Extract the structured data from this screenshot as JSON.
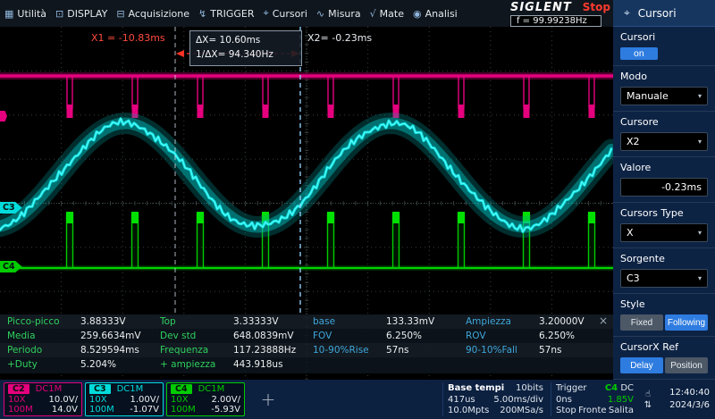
{
  "topbar": {
    "menu": [
      {
        "label": "Utilità",
        "icon": "▦"
      },
      {
        "label": "DISPLAY",
        "icon": "⊡"
      },
      {
        "label": "Acquisizione",
        "icon": "⊟"
      },
      {
        "label": "TRIGGER",
        "icon": "↯"
      },
      {
        "label": "Cursori",
        "icon": "⌖"
      },
      {
        "label": "Misura",
        "icon": "∿"
      },
      {
        "label": "Mate",
        "icon": "√"
      },
      {
        "label": "Analisi",
        "icon": "◉"
      }
    ],
    "brand": "SIGLENT",
    "acq_status": "Stop",
    "freq_counter": "f = 99.99238Hz"
  },
  "plot": {
    "x1_label": "X1 = -10.83ms",
    "x2_label": "X2= -0.23ms",
    "dx_label": "ΔX= 10.60ms",
    "inv_dx_label": "1/ΔX= 94.340Hz",
    "c3_tab": "C3",
    "c4_tab": "C4"
  },
  "measure": {
    "close_icon": "×",
    "rows": [
      [
        {
          "l": "Picco-picco",
          "v": "3.88333V",
          "c": "g"
        },
        {
          "l": "Top",
          "v": "3.33333V",
          "c": "g"
        },
        {
          "l": "base",
          "v": "133.33mV",
          "c": "b"
        },
        {
          "l": "Ampiezza",
          "v": "3.20000V",
          "c": "b"
        }
      ],
      [
        {
          "l": "Media",
          "v": "259.6634mV",
          "c": "g"
        },
        {
          "l": "Dev std",
          "v": "648.0839mV",
          "c": "g"
        },
        {
          "l": "FOV",
          "v": "6.250%",
          "c": "b"
        },
        {
          "l": "ROV",
          "v": "6.250%",
          "c": "b"
        }
      ],
      [
        {
          "l": "Periodo",
          "v": "8.529594ms",
          "c": "g"
        },
        {
          "l": "Frequenza",
          "v": "117.23888Hz",
          "c": "g"
        },
        {
          "l": "10-90%Rise",
          "v": "57ns",
          "c": "b"
        },
        {
          "l": "90-10%Fall",
          "v": "57ns",
          "c": "b"
        }
      ],
      [
        {
          "l": "+Duty",
          "v": "5.204%",
          "c": "g"
        },
        {
          "l": "+ ampiezza",
          "v": "443.918us",
          "c": "g"
        }
      ]
    ]
  },
  "sidebar": {
    "title": "Cursori",
    "title_icon": "⌖",
    "chevron": "▾",
    "sections": [
      {
        "type": "toggle",
        "label": "Cursori",
        "value": "on"
      },
      {
        "type": "select",
        "label": "Modo",
        "value": "Manuale"
      },
      {
        "type": "select",
        "label": "Cursore",
        "value": "X2"
      },
      {
        "type": "field",
        "label": "Valore",
        "value": "-0.23ms"
      },
      {
        "type": "select",
        "label": "Cursors Type",
        "value": "X"
      },
      {
        "type": "select",
        "label": "Sorgente",
        "value": "C3"
      },
      {
        "type": "segmented",
        "label": "Style",
        "options": [
          "Fixed",
          "Following"
        ],
        "active": 1
      },
      {
        "type": "segmented",
        "label": "CursorX Ref",
        "options": [
          "Delay",
          "Position"
        ],
        "active": 0
      }
    ]
  },
  "statusbar": {
    "channels": [
      {
        "name": "C2",
        "coupling": "DC1M",
        "probe": "10X",
        "scale": "10.0V/",
        "bw": "100M",
        "offset": "14.0V",
        "color": "#e6007e"
      },
      {
        "name": "C3",
        "coupling": "DC1M",
        "probe": "10X",
        "scale": "1.00V/",
        "bw": "100M",
        "offset": "-1.07V",
        "color": "#00dcdc"
      },
      {
        "name": "C4",
        "coupling": "DC1M",
        "probe": "10X",
        "scale": "2.00V/",
        "bw": "100M",
        "offset": "-5.93V",
        "color": "#00cc00"
      }
    ],
    "crosshair_icon": "+",
    "timebase": {
      "label": "Base tempi",
      "bits": "10bits",
      "delay": "417us",
      "scale": "5.00ms/div",
      "depth": "10.0Mpts",
      "rate": "200MSa/s"
    },
    "trigger": {
      "label": "Trigger",
      "source": "C4",
      "coupling": "DC",
      "holdoff": "0ns",
      "level": "1.85V",
      "status": "Stop",
      "type": "Fronte",
      "slope": "Salita"
    },
    "icons": {
      "touch": "☝",
      "io": "⇅"
    },
    "clock": {
      "time": "12:40:40",
      "date": "2024/3/6"
    }
  },
  "scope_signals": {
    "c2_color": "#e6007e",
    "c3_color": "#0ce8e8",
    "c4_color": "#00cc00",
    "cursor_red": "#ff3226",
    "grid_color": "#3f4a4a"
  }
}
